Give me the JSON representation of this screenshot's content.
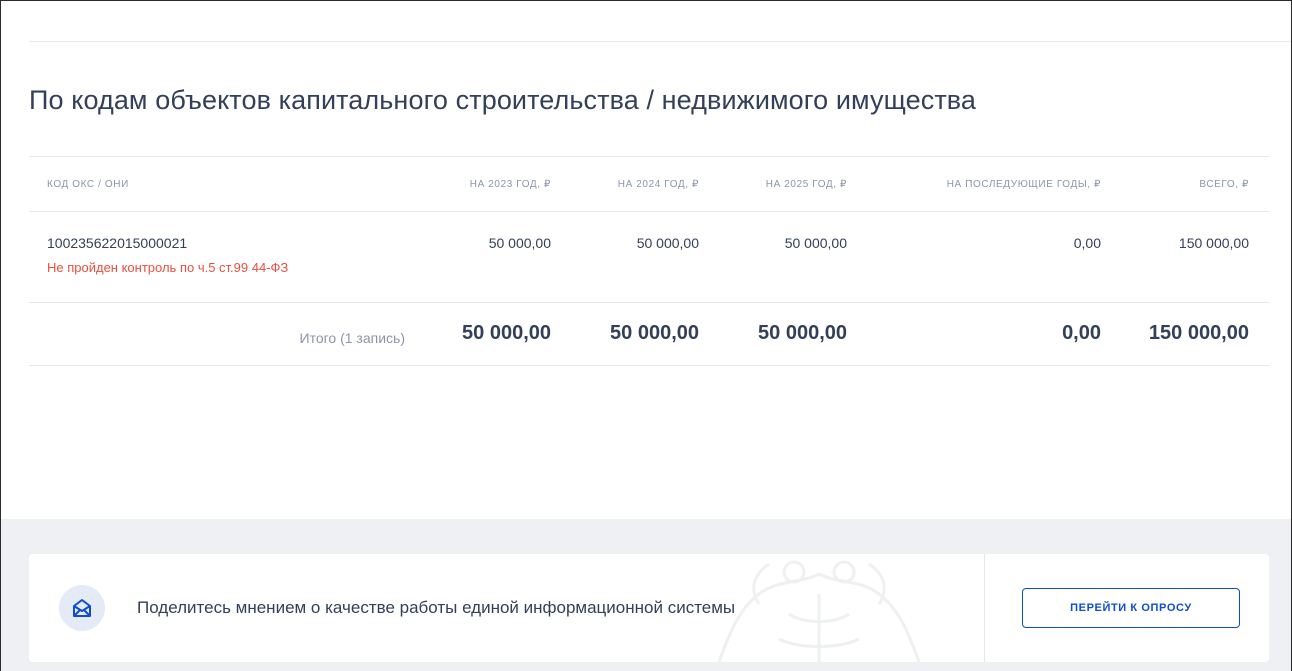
{
  "section": {
    "title": "По кодам объектов капитального строительства / недвижимого имущества"
  },
  "table": {
    "columns": [
      "КОД ОКС / ОНИ",
      "НА 2023 ГОД, ₽",
      "НА 2024 ГОД, ₽",
      "НА 2025 ГОД, ₽",
      "НА ПОСЛЕДУЮЩИЕ ГОДЫ, ₽",
      "ВСЕГО, ₽"
    ],
    "rows": [
      {
        "code": "100235622015000021",
        "error": "Не пройден контроль по ч.5 ст.99 44-ФЗ",
        "y2023": "50 000,00",
        "y2024": "50 000,00",
        "y2025": "50 000,00",
        "later": "0,00",
        "total": "150 000,00"
      }
    ],
    "totals": {
      "label": "Итого (1 запись)",
      "y2023": "50 000,00",
      "y2024": "50 000,00",
      "y2025": "50 000,00",
      "later": "0,00",
      "total": "150 000,00"
    }
  },
  "survey": {
    "icon": "envelope-icon",
    "text": "Поделитесь мнением о качестве работы единой информационной системы",
    "button_label": "ПЕРЕЙТИ К ОПРОСУ"
  },
  "colors": {
    "accent": "#0d4cd3",
    "error": "#eb4f3c",
    "text": "#334059",
    "muted": "#8a96a8",
    "footer_bg": "#eef0f3"
  }
}
